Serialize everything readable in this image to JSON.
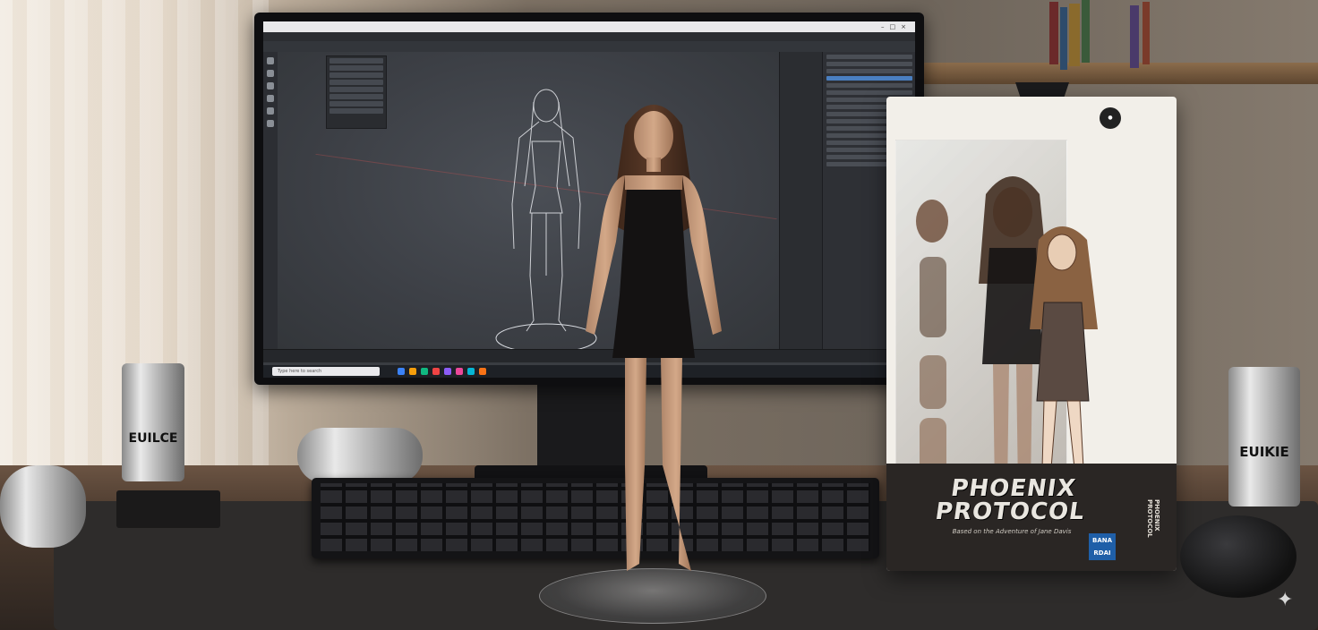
{
  "scene": "desk-photo",
  "box": {
    "title_line1": "PHOENIX",
    "title_line2": "PROTOCOL",
    "subtitle": "Based on the Adventure of Jane Davis",
    "logo_line1": "BANA",
    "logo_line2": "RDAI",
    "side_text": "PHOENIX PROTOCOL"
  },
  "cans": {
    "left_label": "EUILCE",
    "right_label": "EUIKIE"
  },
  "screen": {
    "taskbar_search": "Type here to search"
  },
  "colors": {
    "accent_blue": "#4a7fc0",
    "logo_blue": "#1f5fa8"
  }
}
